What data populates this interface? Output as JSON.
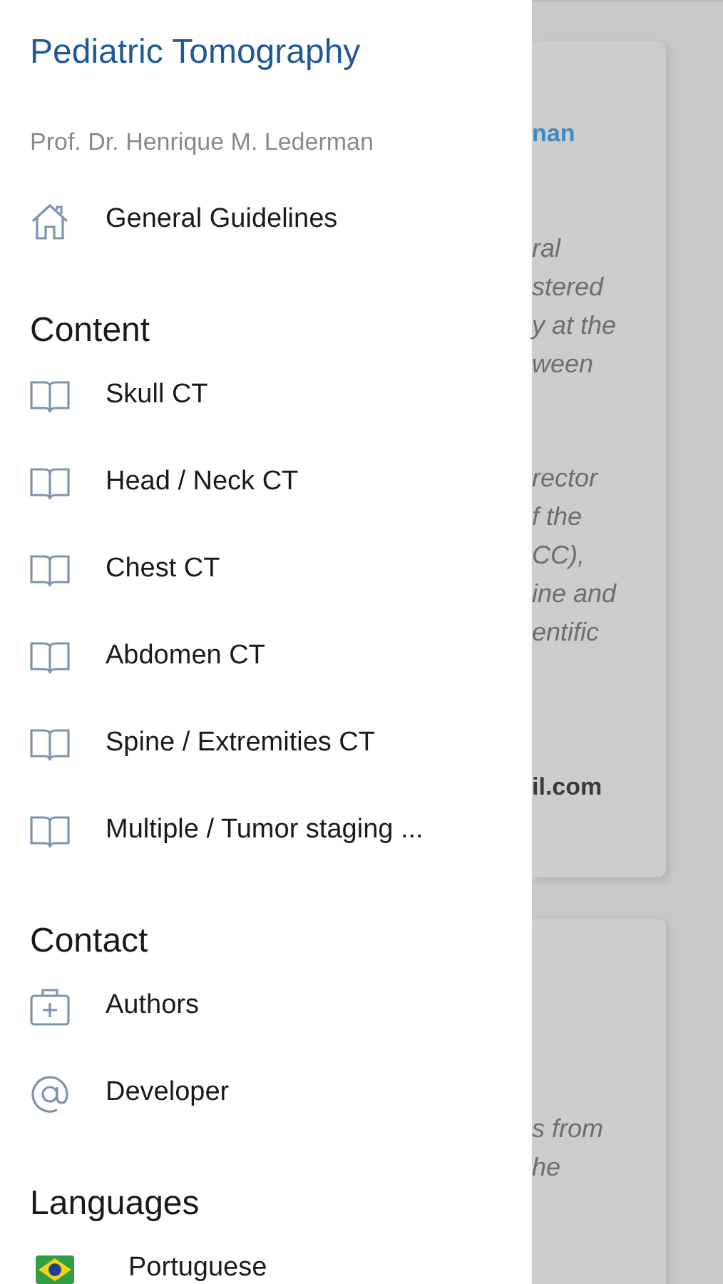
{
  "drawer": {
    "title": "Pediatric Tomography",
    "subtitle": "Prof. Dr. Henrique M. Lederman",
    "top_items": [
      {
        "kind": "home",
        "label": "General Guidelines"
      }
    ],
    "sections": [
      {
        "heading": "Content",
        "items": [
          {
            "kind": "book",
            "label": "Skull CT"
          },
          {
            "kind": "book",
            "label": "Head / Neck CT"
          },
          {
            "kind": "book",
            "label": "Chest CT"
          },
          {
            "kind": "book",
            "label": "Abdomen CT"
          },
          {
            "kind": "book",
            "label": "Spine / Extremities CT"
          },
          {
            "kind": "book",
            "label": "Multiple / Tumor staging ..."
          }
        ]
      },
      {
        "heading": "Contact",
        "items": [
          {
            "kind": "medkit",
            "label": "Authors"
          },
          {
            "kind": "at",
            "label": "Developer"
          }
        ]
      },
      {
        "heading": "Languages",
        "items": [
          {
            "kind": "flag",
            "label": "Portuguese"
          }
        ]
      }
    ]
  },
  "background": {
    "cards": [
      {
        "groups": [
          {
            "kind": "link",
            "lines": [
              "nan"
            ]
          },
          {
            "kind": "italic",
            "lines": [
              "ral",
              "stered",
              "y at the",
              "ween"
            ]
          },
          {
            "kind": "italic",
            "lines": [
              "rector",
              "f the",
              "CC),",
              "ine and",
              "entific"
            ]
          },
          {
            "kind": "bold",
            "lines": [
              "il.com"
            ]
          }
        ]
      },
      {
        "groups": [
          {
            "kind": "italic",
            "lines": [
              "s from",
              "he"
            ]
          }
        ]
      }
    ]
  }
}
